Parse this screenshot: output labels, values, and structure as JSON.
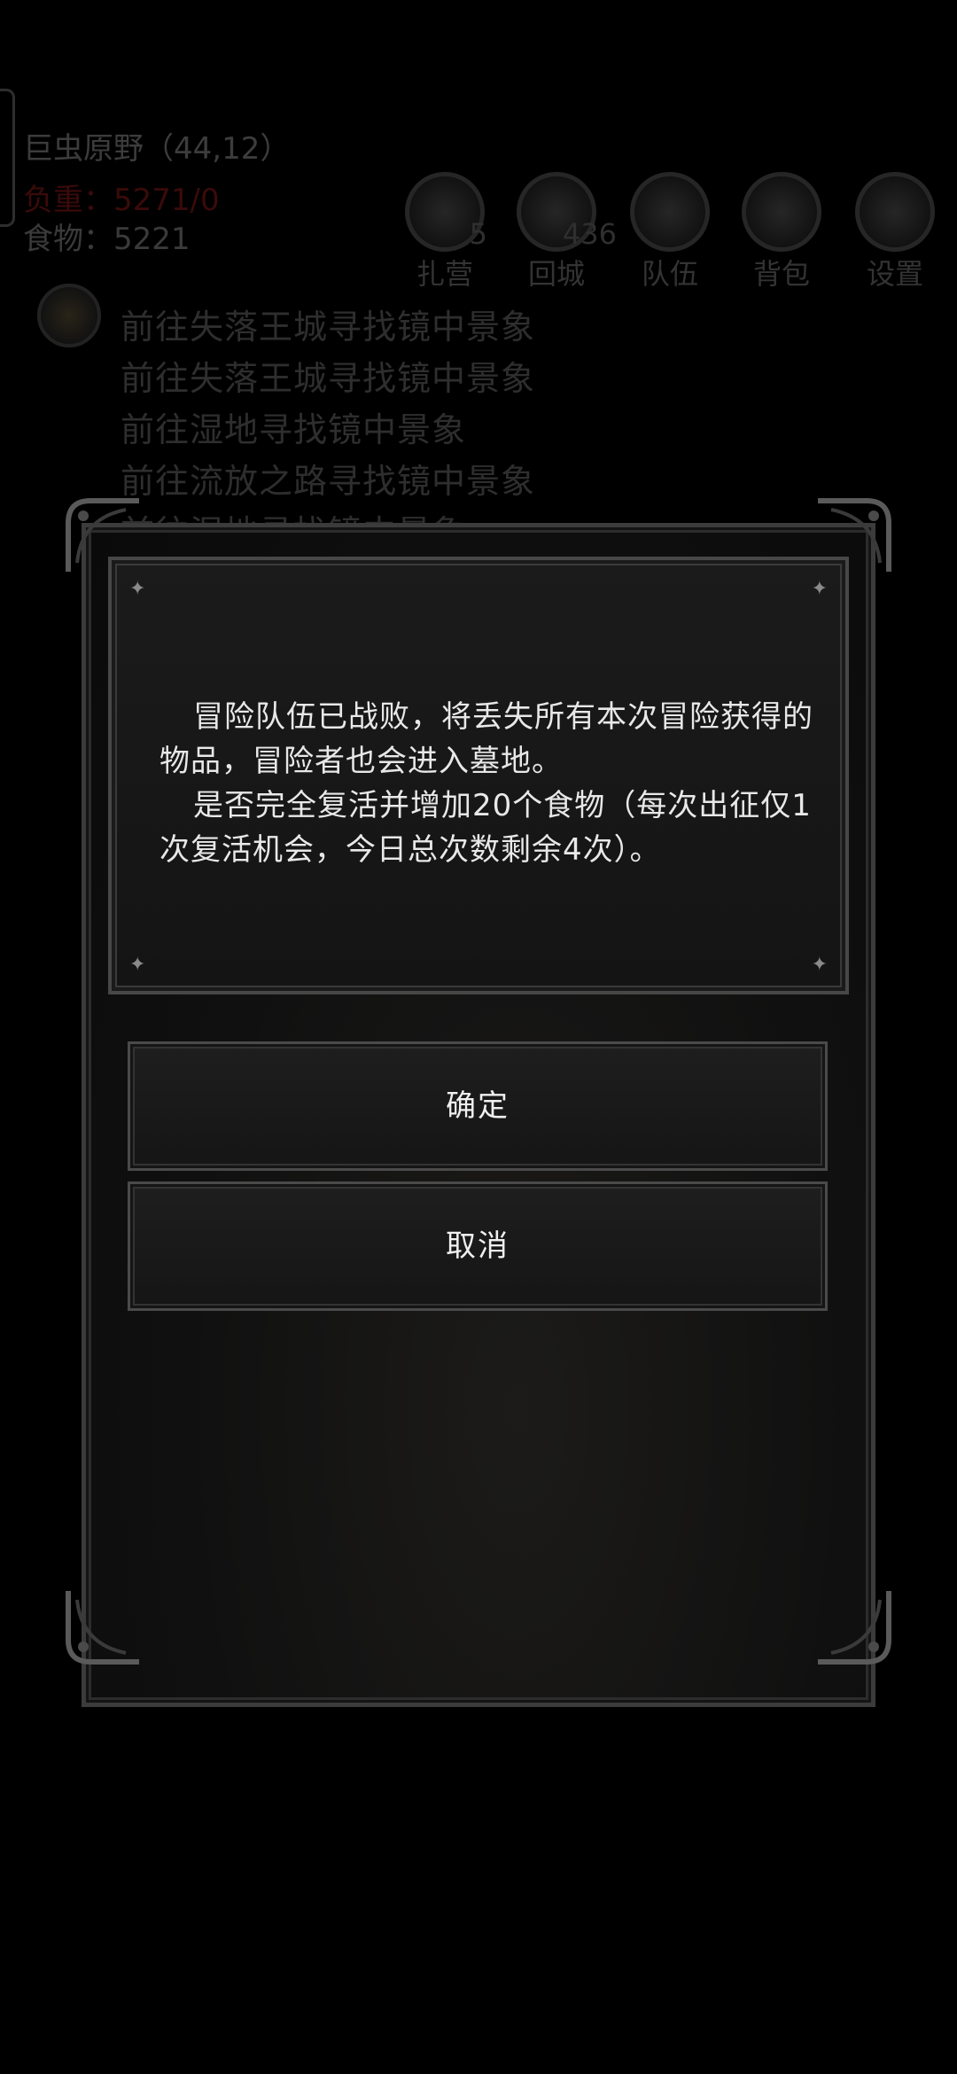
{
  "hud": {
    "location": "巨虫原野（44,12）",
    "hp": "负重：5271/0",
    "food": "食物：5221",
    "buttons": [
      {
        "label": "扎营",
        "badge": "5",
        "icon": "campfire-icon"
      },
      {
        "label": "回城",
        "badge": "436",
        "icon": "portal-icon"
      },
      {
        "label": "队伍",
        "badge": "",
        "icon": "team-icon"
      },
      {
        "label": "背包",
        "badge": "",
        "icon": "backpack-icon"
      },
      {
        "label": "设置",
        "badge": "",
        "icon": "gear-icon"
      }
    ],
    "quests": [
      "前往失落王城寻找镜中景象",
      "前往失落王城寻找镜中景象",
      "前往湿地寻找镜中景象",
      "前往流放之路寻找镜中景象",
      "前往湿地寻找镜中景象"
    ]
  },
  "dialog": {
    "paragraph1": "冒险队伍已战败，将丢失所有本次冒险获得的物品，冒险者也会进入墓地。",
    "paragraph2": "是否完全复活并增加20个食物（每次出征仅1次复活机会，今日总次数剩余4次）。",
    "confirm_label": "确定",
    "cancel_label": "取消"
  }
}
